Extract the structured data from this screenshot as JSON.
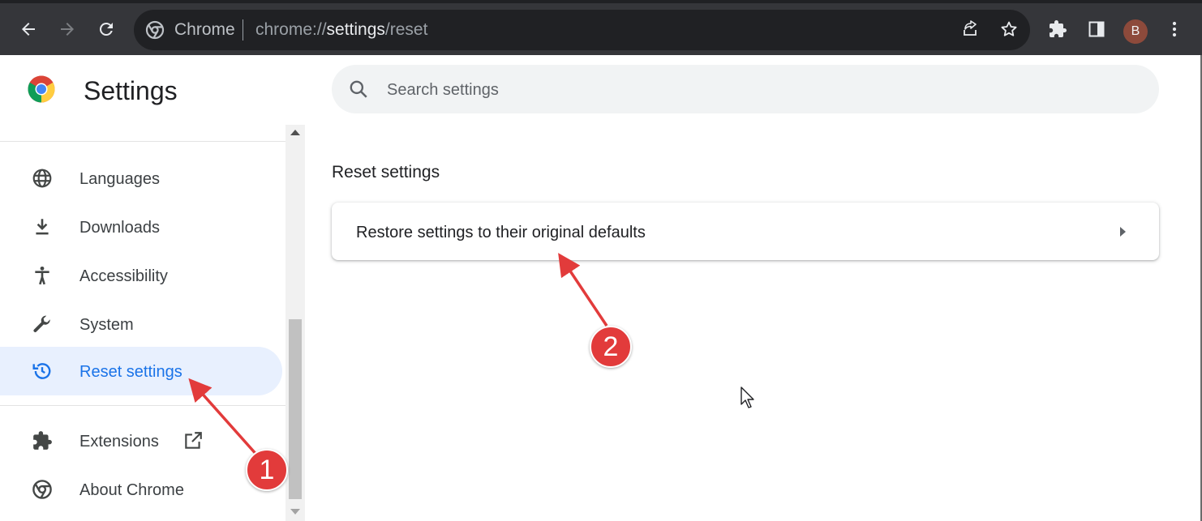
{
  "colors": {
    "toolbar_bg": "#35363a",
    "omnibox_bg": "#202124",
    "accent": "#1a73e8",
    "active_nav_bg": "#e8f0fe",
    "annotation_red": "#e23b3b",
    "avatar_bg": "#8d4a3b"
  },
  "browser": {
    "omnibox": {
      "site_name": "Chrome",
      "url_scheme": "chrome://",
      "url_host": "settings",
      "url_path": "/reset"
    },
    "avatar_letter": "B",
    "icons": [
      "back-icon",
      "forward-icon",
      "reload-icon",
      "share-icon",
      "bookmark-star-icon",
      "extensions-puzzle-icon",
      "side-panel-icon",
      "more-vert-icon"
    ]
  },
  "header": {
    "title": "Settings"
  },
  "search": {
    "placeholder": "Search settings",
    "value": ""
  },
  "sidebar": {
    "items": [
      {
        "label": "Languages",
        "icon": "globe-icon",
        "active": false
      },
      {
        "label": "Downloads",
        "icon": "download-icon",
        "active": false
      },
      {
        "label": "Accessibility",
        "icon": "accessibility-icon",
        "active": false
      },
      {
        "label": "System",
        "icon": "wrench-icon",
        "active": false
      },
      {
        "label": "Reset settings",
        "icon": "restore-history-icon",
        "active": true
      },
      {
        "label": "Extensions",
        "icon": "puzzle-icon",
        "active": false
      },
      {
        "label": "About Chrome",
        "icon": "chrome-icon",
        "active": false
      }
    ]
  },
  "main": {
    "section_title": "Reset settings",
    "card": {
      "label": "Restore settings to their original defaults"
    }
  },
  "annotations": {
    "badge_1": "1",
    "badge_2": "2"
  }
}
